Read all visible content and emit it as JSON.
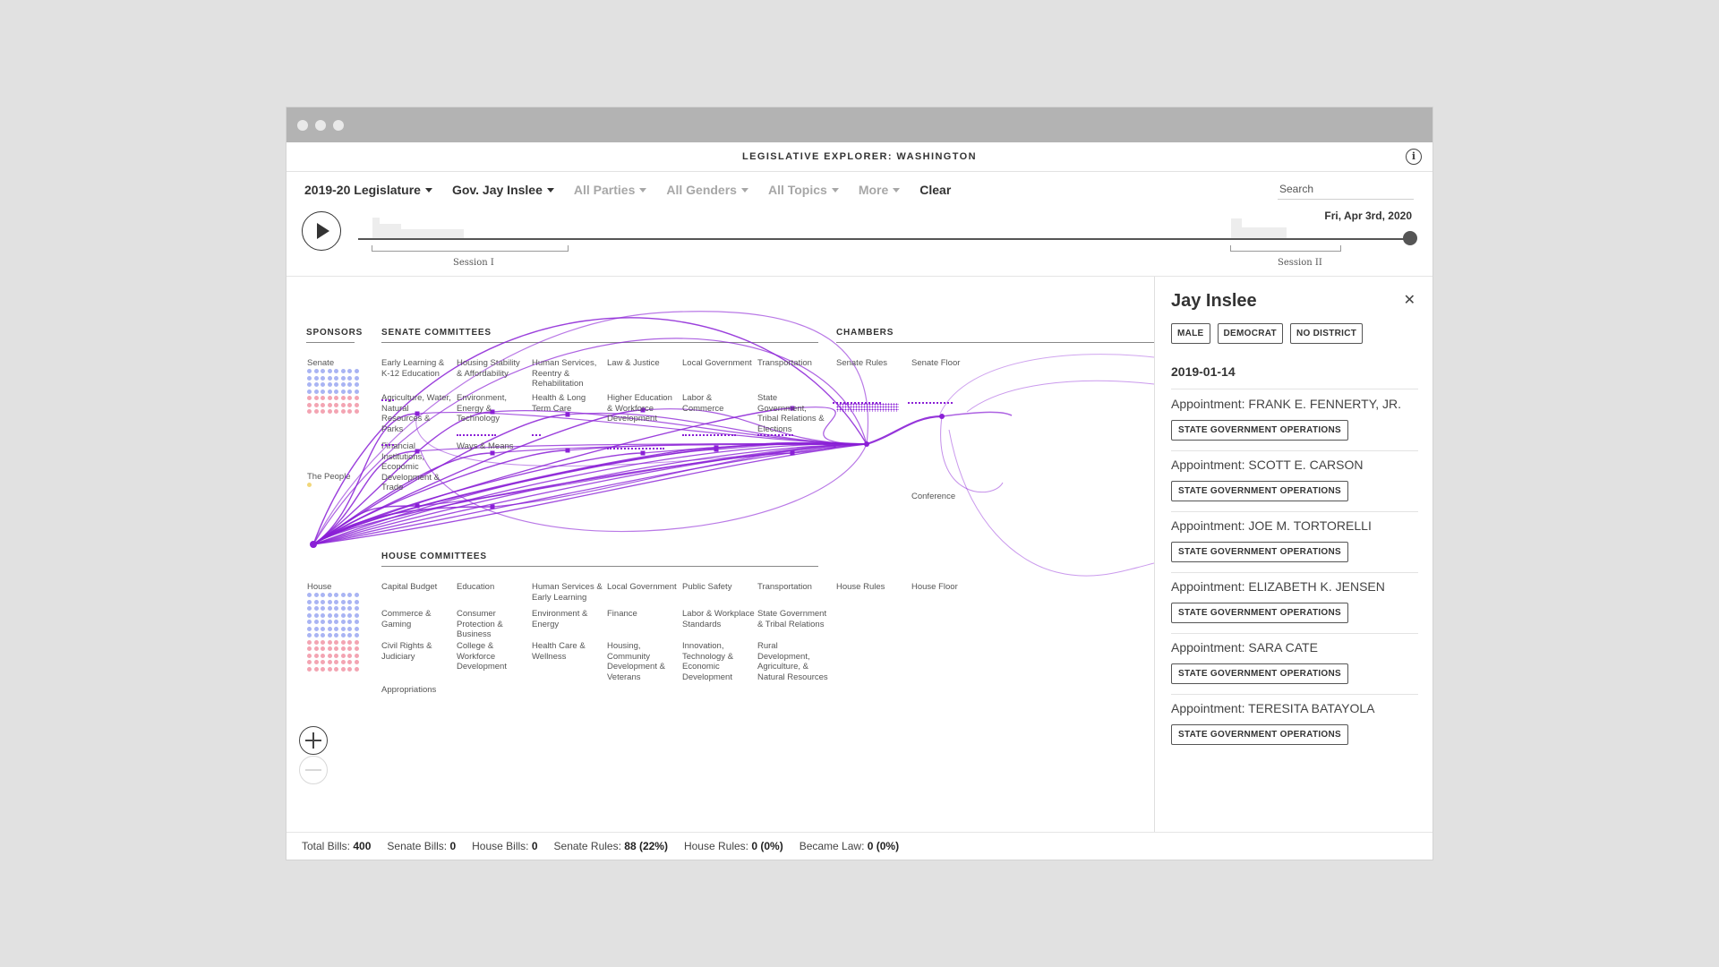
{
  "window": {
    "title": "LEGISLATIVE EXPLORER: WASHINGTON",
    "info_icon": "info-icon",
    "info_glyph": "i"
  },
  "filters": [
    {
      "label": "2019-20 Legislature",
      "dim": false
    },
    {
      "label": "Gov. Jay Inslee",
      "dim": false
    },
    {
      "label": "All Parties",
      "dim": true
    },
    {
      "label": "All Genders",
      "dim": true
    },
    {
      "label": "All Topics",
      "dim": true
    },
    {
      "label": "More",
      "dim": true
    }
  ],
  "clear_label": "Clear",
  "search": {
    "placeholder": "Search"
  },
  "timeline": {
    "date": "Fri, Apr 3rd, 2020",
    "sessions": [
      "Session I",
      "Session II"
    ],
    "progress": 1.0
  },
  "graph": {
    "sections": {
      "sponsors": "SPONSORS",
      "senate_committees": "SENATE COMMITTEES",
      "chambers": "CHAMBERS",
      "house_committees": "HOUSE COMMITTEES"
    },
    "sponsor_groups": [
      "Senate",
      "The People",
      "House"
    ],
    "senate_committees": [
      "Early Learning & K-12 Education",
      "Housing Stability & Affordability",
      "Human Services, Reentry & Rehabilitation",
      "Law & Justice",
      "Local Government",
      "Transportation",
      "Agriculture, Water, Natural Resources & Parks",
      "Environment, Energy & Technology",
      "Health & Long Term Care",
      "Higher Education & Workforce Development",
      "Labor & Commerce",
      "State Government, Tribal Relations & Elections",
      "Financial Institutions, Economic Development & Trade",
      "Ways & Means"
    ],
    "chambers": [
      "Senate Rules",
      "Senate Floor",
      "Conference",
      "House Rules",
      "House Floor"
    ],
    "house_committees": [
      "Capital Budget",
      "Education",
      "Human Services & Early Learning",
      "Local Government",
      "Public Safety",
      "Transportation",
      "Commerce & Gaming",
      "Consumer Protection & Business",
      "Environment & Energy",
      "Finance",
      "Labor & Workplace Standards",
      "State Government & Tribal Relations",
      "Civil Rights & Judiciary",
      "College & Workforce Development",
      "Health Care & Wellness",
      "Housing, Community Development & Veterans",
      "Innovation, Technology & Economic Development",
      "Rural Development, Agriculture, & Natural Resources",
      "Appropriations"
    ],
    "colors": {
      "flow": "#8a1fd6",
      "democrat": "#a9b4f3",
      "republican": "#f3a4b2",
      "people": "#f1d77a"
    }
  },
  "panel": {
    "name": "Jay Inslee",
    "tags": [
      "MALE",
      "DEMOCRAT",
      "NO DISTRICT"
    ],
    "date": "2019-01-14",
    "close_glyph": "✕",
    "items": [
      {
        "title": "Appointment: FRANK E. FENNERTY, JR.",
        "committee": "STATE GOVERNMENT OPERATIONS"
      },
      {
        "title": "Appointment: SCOTT E. CARSON",
        "committee": "STATE GOVERNMENT OPERATIONS"
      },
      {
        "title": "Appointment: JOE M. TORTORELLI",
        "committee": "STATE GOVERNMENT OPERATIONS"
      },
      {
        "title": "Appointment: ELIZABETH K. JENSEN",
        "committee": "STATE GOVERNMENT OPERATIONS"
      },
      {
        "title": "Appointment: SARA CATE",
        "committee": "STATE GOVERNMENT OPERATIONS"
      },
      {
        "title": "Appointment: TERESITA BATAYOLA",
        "committee": "STATE GOVERNMENT OPERATIONS"
      }
    ]
  },
  "stats": [
    {
      "label": "Total Bills:",
      "value": "400"
    },
    {
      "label": "Senate Bills:",
      "value": "0"
    },
    {
      "label": "House Bills:",
      "value": "0"
    },
    {
      "label": "Senate Rules:",
      "value": "88 (22%)"
    },
    {
      "label": "House Rules:",
      "value": "0 (0%)"
    },
    {
      "label": "Became Law:",
      "value": "0 (0%)"
    }
  ]
}
